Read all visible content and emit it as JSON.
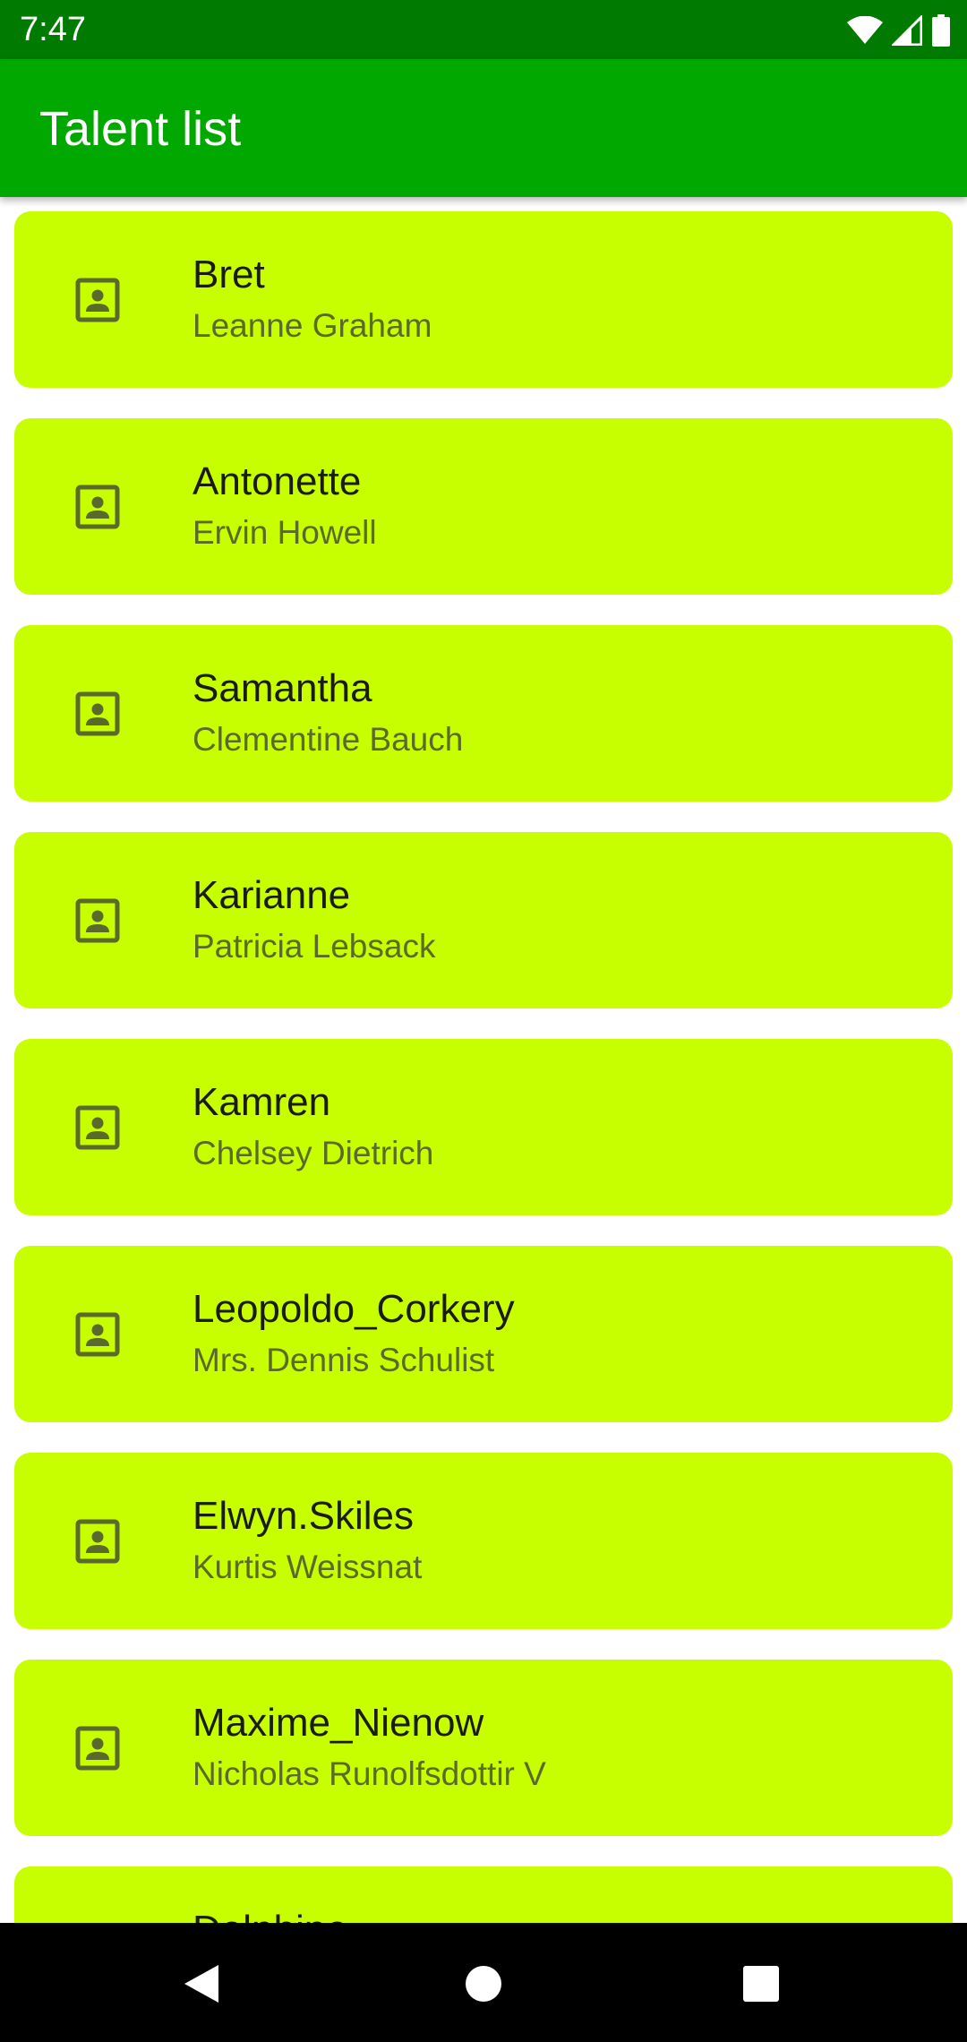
{
  "status_bar": {
    "time": "7:47",
    "icons": [
      "wifi-icon",
      "cellular-signal-icon",
      "battery-icon"
    ]
  },
  "app_bar": {
    "title": "Talent list",
    "color": "#00a800",
    "status_color": "#007a00"
  },
  "card_color": "#c8ff00",
  "talents": [
    {
      "username": "Bret",
      "name": "Leanne Graham",
      "icon": "contact-portrait-icon"
    },
    {
      "username": "Antonette",
      "name": "Ervin Howell",
      "icon": "contact-portrait-icon"
    },
    {
      "username": "Samantha",
      "name": "Clementine Bauch",
      "icon": "contact-portrait-icon"
    },
    {
      "username": "Karianne",
      "name": "Patricia Lebsack",
      "icon": "contact-portrait-icon"
    },
    {
      "username": "Kamren",
      "name": "Chelsey Dietrich",
      "icon": "contact-portrait-icon"
    },
    {
      "username": "Leopoldo_Corkery",
      "name": "Mrs. Dennis Schulist",
      "icon": "contact-portrait-icon"
    },
    {
      "username": "Elwyn.Skiles",
      "name": "Kurtis Weissnat",
      "icon": "contact-portrait-icon"
    },
    {
      "username": "Maxime_Nienow",
      "name": "Nicholas Runolfsdottir V",
      "icon": "contact-portrait-icon"
    },
    {
      "username": "Delphine",
      "name": "",
      "icon": "contact-portrait-icon"
    }
  ],
  "nav_bar": {
    "buttons": [
      "back-icon",
      "home-icon",
      "recents-icon"
    ]
  }
}
